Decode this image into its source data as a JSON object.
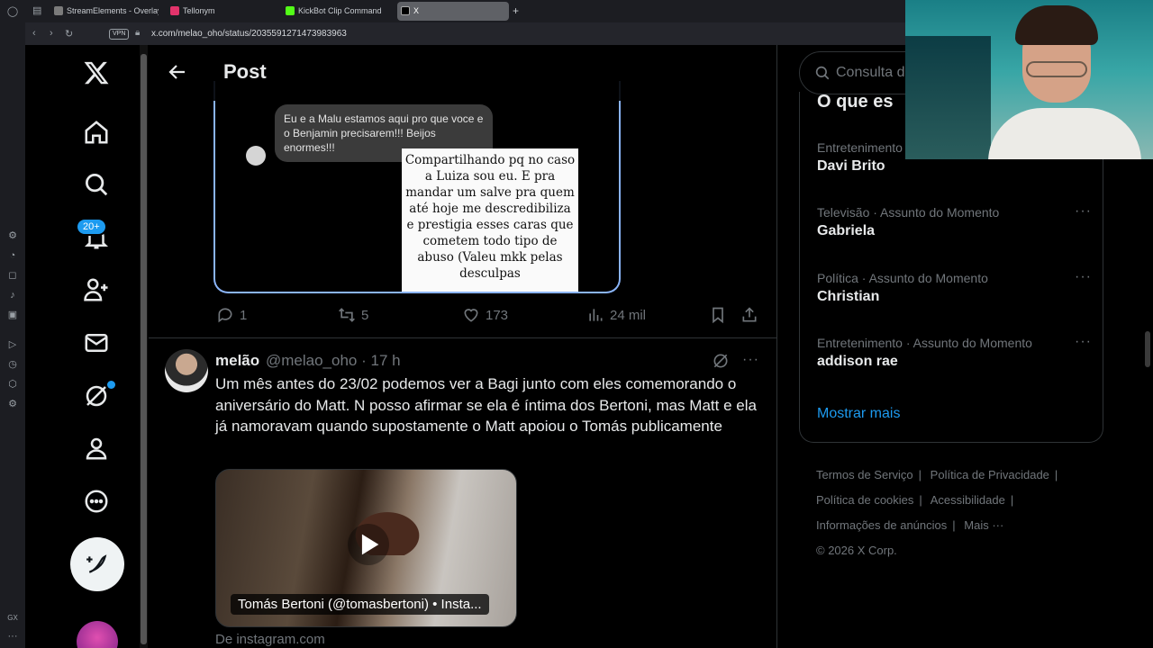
{
  "browser": {
    "tabs": [
      {
        "label": "StreamElements - Overlay",
        "fav_color": "#7b7b7b"
      },
      {
        "label": "Tellonym",
        "fav_color": "#e2336b"
      },
      {
        "label": "KickBot Clip Command",
        "fav_color": "#53fc18"
      },
      {
        "label": "X",
        "fav_color": "#000000"
      }
    ],
    "url": "x.com/melao_oho/status/2035591271473983963",
    "vpn_label": "VPN",
    "new_tab": "+"
  },
  "nav": {
    "notifications_badge": "20+",
    "icons": [
      "x-logo-icon",
      "home-icon",
      "search-icon",
      "bell-icon",
      "follow-icon",
      "mail-icon",
      "grok-icon",
      "profile-icon",
      "more-icon"
    ]
  },
  "main": {
    "header_title": "Post",
    "dm_message": "Eu e a Malu estamos aqui pro que voce e o Benjamin precisarem!!! Beijos enormes!!!",
    "note_text": "Compartilhando pq no caso a Luiza sou eu. E pra mandar um salve pra quem até hoje me descredibiliza e prestigia esses caras que cometem todo tipo de abuso (Valeu mkk pelas desculpas",
    "stats": {
      "replies": "1",
      "reposts": "5",
      "likes": "173",
      "views": "24 mil"
    }
  },
  "tweet": {
    "name": "melão",
    "handle": "@melao_oho · 17 h",
    "text": "Um mês antes do 23/02 podemos ver a Bagi junto com eles comemorando o aniversário do Matt. N posso afirmar se ela é íntima dos Bertoni, mas Matt e ela já namoravam quando supostamente o Matt apoiou o Tomás publicamente",
    "media_caption": "Tomás Bertoni (@tomasbertoni) • Insta...",
    "source": "De instagram.com"
  },
  "right": {
    "search_placeholder": "Consulta de",
    "trends_title": "O que es",
    "trends": [
      {
        "meta": "Entretenimento ·",
        "name": "Davi Brito"
      },
      {
        "meta": "Televisão · Assunto do Momento",
        "name": "Gabriela"
      },
      {
        "meta": "Política · Assunto do Momento",
        "name": "Christian"
      },
      {
        "meta": "Entretenimento · Assunto do Momento",
        "name": "addison rae"
      }
    ],
    "show_more": "Mostrar mais",
    "footer": {
      "terms": "Termos de Serviço",
      "privacy": "Política de Privacidade",
      "cookies": "Política de cookies",
      "accessibility": "Acessibilidade",
      "ads": "Informações de anúncios",
      "more": "Mais ···",
      "copyright": "© 2026 X Corp."
    }
  },
  "colors": {
    "accent": "#1d9bf0",
    "background": "#000000",
    "muted": "#71767b"
  }
}
